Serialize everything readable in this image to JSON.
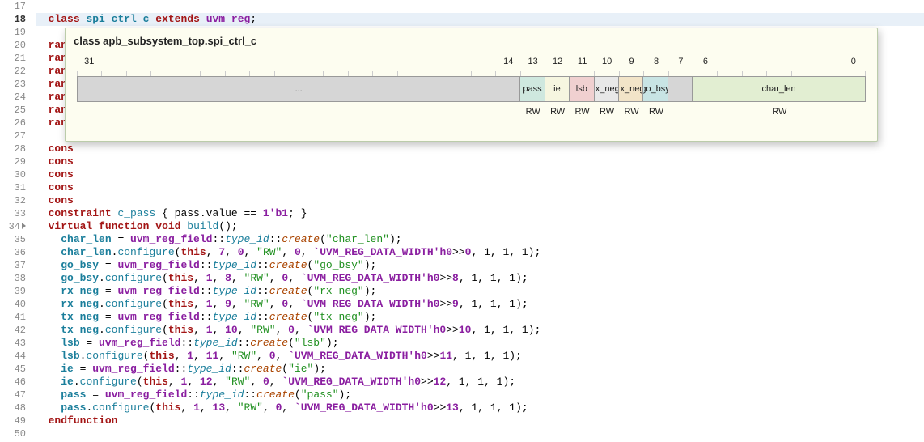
{
  "lines": [
    17,
    18,
    19,
    20,
    21,
    22,
    23,
    24,
    25,
    26,
    27,
    28,
    29,
    30,
    31,
    32,
    33,
    34,
    35,
    36,
    37,
    38,
    39,
    40,
    41,
    42,
    43,
    44,
    45,
    46,
    47,
    48,
    49,
    50
  ],
  "highlighted_line": 18,
  "arrow_line": 34,
  "tokens": {
    "class": "class",
    "extends": "extends",
    "rand": "rand",
    "cons": "cons",
    "constraint": "constraint",
    "virtual": "virtual",
    "function": "function",
    "void": "void",
    "this": "this",
    "endfunction": "endfunction"
  },
  "identifiers": {
    "class_name": "spi_ctrl_c",
    "base_class": "uvm_reg",
    "build": "build",
    "create": "create",
    "configure": "configure",
    "uvm_reg_field": "uvm_reg_field",
    "type_id": "type_id",
    "c_pass": "c_pass",
    "pass_value": "pass.value",
    "eq": "==",
    "one_b1": "1'b1",
    "macro": "`UVM_REG_DATA_WIDTH",
    "h0": "'h0"
  },
  "fields": {
    "char_len": "char_len",
    "go_bsy": "go_bsy",
    "rx_neg": "rx_neg",
    "tx_neg": "tx_neg",
    "lsb": "lsb",
    "ie": "ie",
    "pass": "pass"
  },
  "strings": {
    "char_len": "\"char_len\"",
    "go_bsy": "\"go_bsy\"",
    "rx_neg": "\"rx_neg\"",
    "tx_neg": "\"tx_neg\"",
    "lsb": "\"lsb\"",
    "ie": "\"ie\"",
    "pass": "\"pass\"",
    "RW": "\"RW\""
  },
  "cfg": {
    "char_len": {
      "w": "7",
      "pos": "0",
      "shift": "0"
    },
    "go_bsy": {
      "w": "1",
      "pos": "8",
      "shift": "8"
    },
    "rx_neg": {
      "w": "1",
      "pos": "9",
      "shift": "9"
    },
    "tx_neg": {
      "w": "1",
      "pos": "10",
      "shift": "10"
    },
    "lsb": {
      "w": "1",
      "pos": "11",
      "shift": "11"
    },
    "ie": {
      "w": "1",
      "pos": "12",
      "shift": "12"
    },
    "pass": {
      "w": "1",
      "pos": "13",
      "shift": "13"
    },
    "zero": "0",
    "one": "1",
    "tail": ", 1, 1, 1);"
  },
  "tooltip": {
    "title": "class apb_subsystem_top.spi_ctrl_c",
    "bit_labels": [
      "31",
      "14",
      "13",
      "12",
      "11",
      "10",
      "9",
      "8",
      "7",
      "6",
      "0"
    ],
    "rw": "RW",
    "ellipsis": "…",
    "fields": [
      {
        "name": "...",
        "bits": 18,
        "class": "reserved",
        "access": ""
      },
      {
        "name": "pass",
        "bits": 1,
        "class": "f-pass",
        "access": "RW"
      },
      {
        "name": "ie",
        "bits": 1,
        "class": "f-ie",
        "access": "RW"
      },
      {
        "name": "lsb",
        "bits": 1,
        "class": "f-lsb",
        "access": "RW"
      },
      {
        "name": "tx_neg",
        "bits": 1,
        "class": "f-tx_neg",
        "access": "RW"
      },
      {
        "name": "rx_neg",
        "bits": 1,
        "class": "f-rx_neg",
        "access": "RW"
      },
      {
        "name": "go_bsy",
        "bits": 1,
        "class": "f-go_bsy",
        "access": "RW"
      },
      {
        "name": "",
        "bits": 1,
        "class": "reserved",
        "access": ""
      },
      {
        "name": "char_len",
        "bits": 7,
        "class": "f-char_len",
        "access": "RW"
      }
    ]
  }
}
